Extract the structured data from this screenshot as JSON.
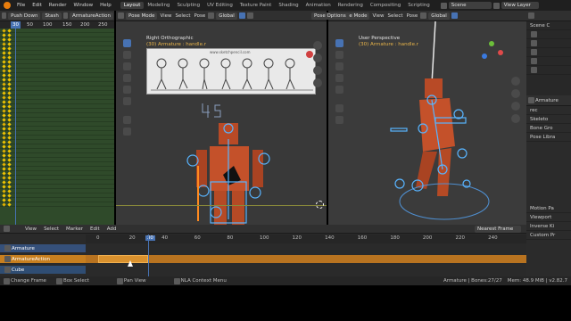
{
  "topbar": {
    "menus": [
      "File",
      "Edit",
      "Render",
      "Window",
      "Help"
    ],
    "workspaces": [
      "Layout",
      "Modeling",
      "Sculpting",
      "UV Editing",
      "Texture Paint",
      "Shading",
      "Animation",
      "Rendering",
      "Compositing",
      "Scripting"
    ],
    "active_workspace": "Layout",
    "scene": "Scene",
    "view_layer": "View Layer"
  },
  "dopesheet": {
    "push_down": "Push Down",
    "stash": "Stash",
    "action": "ArmatureAction",
    "frame_current": "30",
    "ruler": [
      "30",
      "50",
      "100",
      "150",
      "200",
      "250"
    ]
  },
  "viewport_left": {
    "mode": "Pose Mode",
    "menus": [
      "View",
      "Select",
      "Pose"
    ],
    "transform": "Global",
    "view_name": "Right Orthographic",
    "object_info": "(30) Armature : handle.r",
    "ref_image_url": "www.sketchpencil.com"
  },
  "viewport_right": {
    "mode": "Pose Mode",
    "menus": [
      "View",
      "Select",
      "Pose"
    ],
    "transform": "Global",
    "options": "Pose Options",
    "view_name": "User Perspective",
    "object_info": "(30) Armature : handle.r"
  },
  "nla": {
    "menus": [
      "View",
      "Select",
      "Marker",
      "Edit",
      "Add"
    ],
    "interpolation": "Nearest Frame",
    "ruler": [
      "0",
      "20",
      "30",
      "40",
      "60",
      "80",
      "100",
      "120",
      "140",
      "160",
      "180",
      "200",
      "220",
      "240"
    ],
    "current_frame": "30",
    "tracks": [
      {
        "label": "Armature",
        "color": "#4772b3"
      },
      {
        "label": "ArmatureAction",
        "color": "#c77f1f"
      },
      {
        "label": "Cube",
        "color": "#3a5f8f"
      }
    ]
  },
  "outliner": {
    "items": [
      "Scene C",
      "",
      "",
      "",
      ""
    ]
  },
  "properties": {
    "header": "Armature",
    "rows": [
      "rec",
      "Skeleto",
      "Bone Gro",
      "Pose Libra",
      "Motion Pa",
      "Viewport",
      "Inverse Ki",
      "Custom Pr"
    ]
  },
  "status": {
    "change_frame": "Change Frame",
    "box_select": "Box Select",
    "pan_view": "Pan View",
    "context": "NLA Context Menu",
    "stats": "Armature | Bones:27/27",
    "mem": "Mem: 48.9 MiB | v2.82.7"
  }
}
